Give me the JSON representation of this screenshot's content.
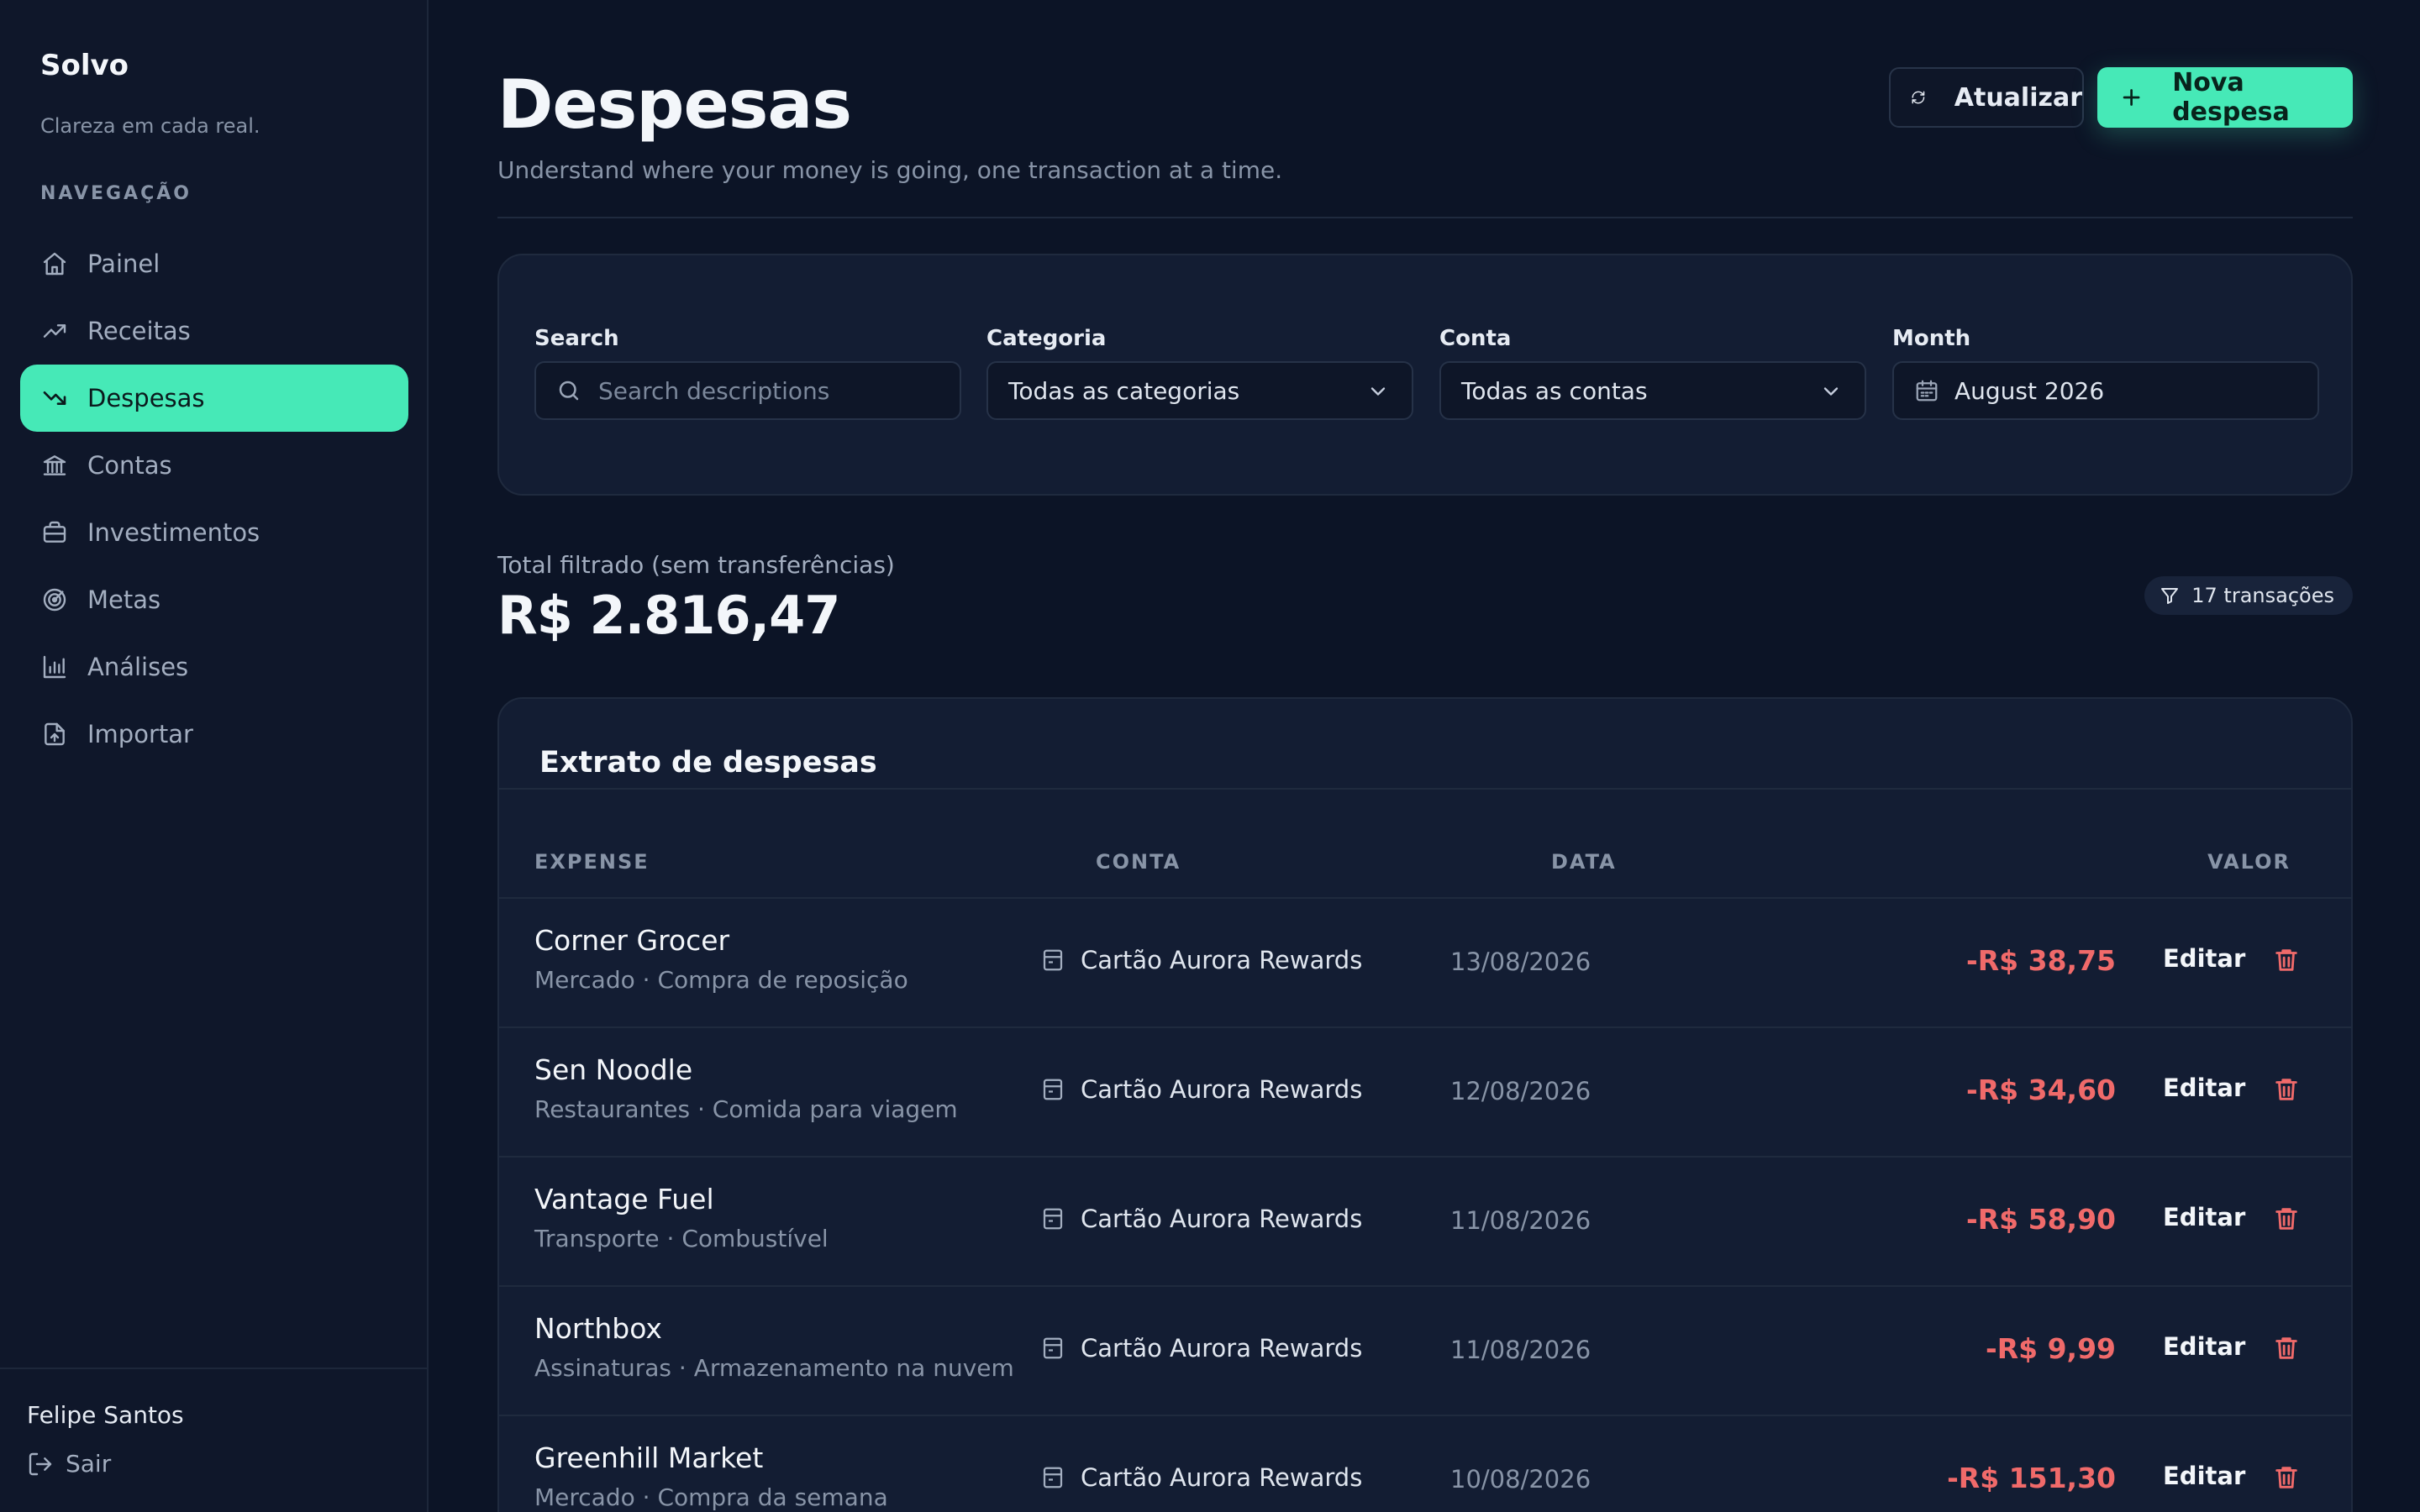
{
  "sidebar": {
    "brand": "Solvo",
    "tagline": "Clareza em cada real.",
    "nav_heading": "NAVEGAÇÃO",
    "items": [
      {
        "label": "Painel",
        "icon": "home-icon"
      },
      {
        "label": "Receitas",
        "icon": "trending-up-icon"
      },
      {
        "label": "Despesas",
        "icon": "trending-down-icon",
        "active": true
      },
      {
        "label": "Contas",
        "icon": "bank-icon"
      },
      {
        "label": "Investimentos",
        "icon": "briefcase-icon"
      },
      {
        "label": "Metas",
        "icon": "target-icon"
      },
      {
        "label": "Análises",
        "icon": "bar-chart-icon"
      },
      {
        "label": "Importar",
        "icon": "file-upload-icon"
      }
    ],
    "user_name": "Felipe Santos",
    "logout_label": "Sair"
  },
  "header": {
    "title": "Despesas",
    "subtitle": "Understand where your money is going, one transaction at a time.",
    "refresh_label": "Atualizar",
    "new_label": "Nova despesa"
  },
  "filters": {
    "search_label": "Search",
    "search_placeholder": "Search descriptions",
    "search_value": "",
    "category_label": "Categoria",
    "category_value": "Todas as categorias",
    "account_label": "Conta",
    "account_value": "Todas as contas",
    "month_label": "Month",
    "month_value": "August 2026"
  },
  "summary": {
    "total_label": "Total filtrado (sem transferências)",
    "total_value": "R$ 2.816,47",
    "count": "17 transações"
  },
  "table": {
    "title": "Extrato de despesas",
    "headers": {
      "expense": "EXPENSE",
      "account": "CONTA",
      "date": "DATA",
      "value": "VALOR"
    },
    "edit_label": "Editar",
    "rows": [
      {
        "name": "Corner Grocer",
        "meta": "Mercado · Compra de reposição",
        "account": "Cartão Aurora Rewards",
        "date": "13/08/2026",
        "amount": "-R$ 38,75"
      },
      {
        "name": "Sen Noodle",
        "meta": "Restaurantes · Comida para viagem",
        "account": "Cartão Aurora Rewards",
        "date": "12/08/2026",
        "amount": "-R$ 34,60"
      },
      {
        "name": "Vantage Fuel",
        "meta": "Transporte · Combustível",
        "account": "Cartão Aurora Rewards",
        "date": "11/08/2026",
        "amount": "-R$ 58,90"
      },
      {
        "name": "Northbox",
        "meta": "Assinaturas · Armazenamento na nuvem",
        "account": "Cartão Aurora Rewards",
        "date": "11/08/2026",
        "amount": "-R$ 9,99"
      },
      {
        "name": "Greenhill Market",
        "meta": "Mercado · Compra da semana",
        "account": "Cartão Aurora Rewards",
        "date": "10/08/2026",
        "amount": "-R$ 151,30"
      }
    ]
  },
  "colors": {
    "accent": "#46e9b7",
    "background": "#0c1426",
    "card": "#131d33",
    "negative": "#f06a6a"
  }
}
